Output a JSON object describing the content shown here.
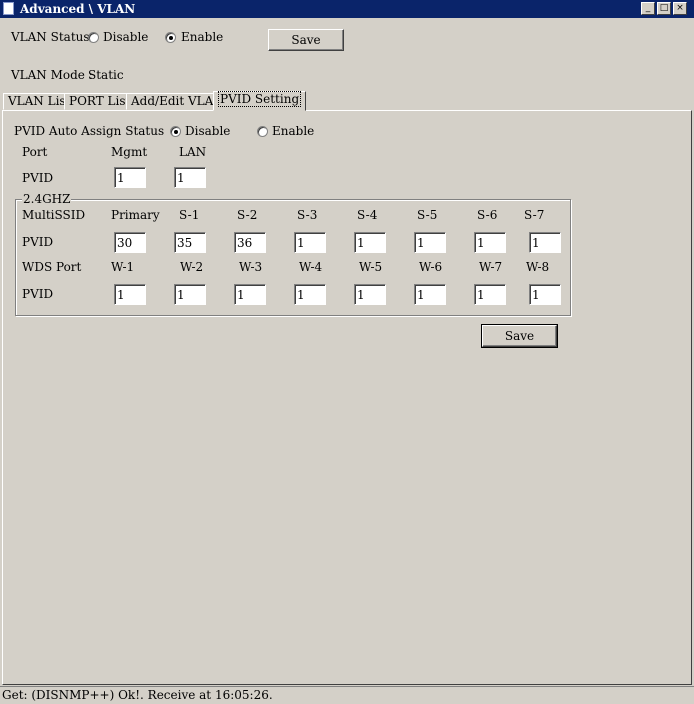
{
  "window": {
    "title": "Advanced \\ VLAN",
    "minimize": "_",
    "maximize": "□",
    "close": "×"
  },
  "vlan_status": {
    "label": "VLAN Status",
    "disable": "Disable",
    "enable": "Enable",
    "selected": "Enable",
    "save": "Save"
  },
  "vlan_mode": {
    "label": "VLAN Mode :",
    "value": "Static"
  },
  "tabs": [
    {
      "label": "VLAN List"
    },
    {
      "label": "PORT List"
    },
    {
      "label": "Add/Edit VLAN"
    },
    {
      "label": "PVID Setting",
      "active": true
    }
  ],
  "pvid": {
    "auto_assign": {
      "label": "PVID Auto Assign Status",
      "disable": "Disable",
      "enable": "Enable",
      "selected": "Disable"
    },
    "port_header": {
      "port": "Port",
      "mgmt": "Mgmt",
      "lan": "LAN"
    },
    "port_row": {
      "label": "PVID",
      "mgmt": "1",
      "lan": "1"
    },
    "group_title": "2.4GHZ",
    "multissid": {
      "label": "MultiSSID",
      "columns": [
        "Primary",
        "S-1",
        "S-2",
        "S-3",
        "S-4",
        "S-5",
        "S-6",
        "S-7"
      ],
      "pvid_label": "PVID",
      "values": [
        "30",
        "35",
        "36",
        "1",
        "1",
        "1",
        "1",
        "1"
      ]
    },
    "wds": {
      "label": "WDS Port",
      "columns": [
        "W-1",
        "W-2",
        "W-3",
        "W-4",
        "W-5",
        "W-6",
        "W-7",
        "W-8"
      ],
      "pvid_label": "PVID",
      "values": [
        "1",
        "1",
        "1",
        "1",
        "1",
        "1",
        "1",
        "1"
      ]
    },
    "save": "Save"
  },
  "statusbar": {
    "text": "Get: (DISNMP++) Ok!. Receive at 16:05:26."
  }
}
